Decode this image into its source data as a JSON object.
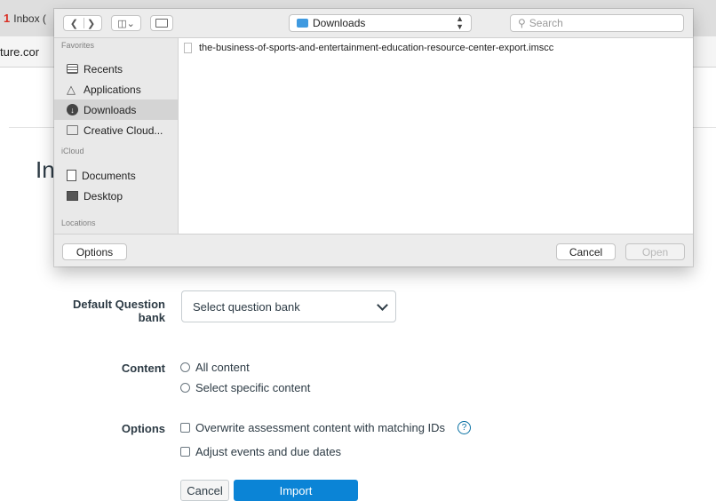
{
  "browser": {
    "tab_label": "Inbox (",
    "url_fragment": "ture.cor"
  },
  "page": {
    "heading_partial": "In",
    "question_bank": {
      "label": "Default Question bank",
      "selected": "Select question bank"
    },
    "content": {
      "label": "Content",
      "options": [
        "All content",
        "Select specific content"
      ]
    },
    "options": {
      "label": "Options",
      "items": [
        "Overwrite assessment content with matching IDs",
        "Adjust events and due dates"
      ],
      "help_glyph": "?"
    },
    "buttons": {
      "cancel": "Cancel",
      "import": "Import"
    }
  },
  "dialog": {
    "location": "Downloads",
    "search_placeholder": "Search",
    "sidebar": {
      "favorites_heading": "Favorites",
      "favorites": [
        "Recents",
        "Applications",
        "Downloads",
        "Creative Cloud..."
      ],
      "icloud_heading": "iCloud",
      "icloud": [
        "Documents",
        "Desktop"
      ],
      "locations_heading": "Locations",
      "selected": "Downloads"
    },
    "files": [
      "the-business-of-sports-and-entertainment-education-resource-center-export.imscc"
    ],
    "footer": {
      "options": "Options",
      "cancel": "Cancel",
      "open": "Open"
    }
  }
}
